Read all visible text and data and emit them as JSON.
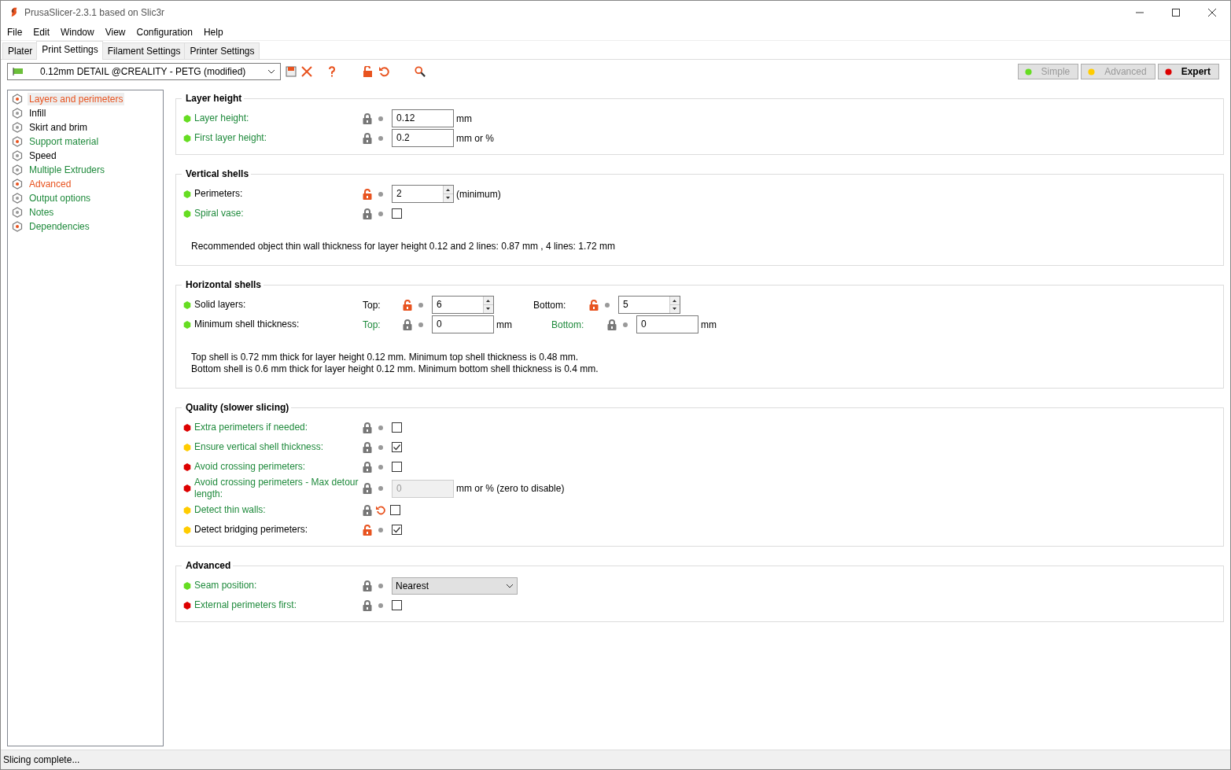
{
  "window": {
    "title": "PrusaSlicer-2.3.1 based on Slic3r"
  },
  "menu": [
    "File",
    "Edit",
    "Window",
    "View",
    "Configuration",
    "Help"
  ],
  "tabs": [
    {
      "label": "Plater",
      "selected": false
    },
    {
      "label": "Print Settings",
      "selected": true
    },
    {
      "label": "Filament Settings",
      "selected": false
    },
    {
      "label": "Printer Settings",
      "selected": false
    }
  ],
  "preset": {
    "value": "0.12mm DETAIL @CREALITY - PETG (modified)"
  },
  "modes": [
    {
      "label": "Simple",
      "color": "#66dd22",
      "selected": false
    },
    {
      "label": "Advanced",
      "color": "#ffcc00",
      "selected": false
    },
    {
      "label": "Expert",
      "color": "#dd0000",
      "selected": true
    }
  ],
  "sidebar": [
    {
      "label": "Layers and perimeters",
      "selected": true,
      "color": "#e8531f"
    },
    {
      "label": "Infill",
      "selected": false,
      "color": "#000000"
    },
    {
      "label": "Skirt and brim",
      "selected": false,
      "color": "#000000"
    },
    {
      "label": "Support material",
      "selected": false,
      "color": "#1f8a3c"
    },
    {
      "label": "Speed",
      "selected": false,
      "color": "#000000"
    },
    {
      "label": "Multiple Extruders",
      "selected": false,
      "color": "#1f8a3c"
    },
    {
      "label": "Advanced",
      "selected": false,
      "color": "#e8531f"
    },
    {
      "label": "Output options",
      "selected": false,
      "color": "#1f8a3c"
    },
    {
      "label": "Notes",
      "selected": false,
      "color": "#1f8a3c"
    },
    {
      "label": "Dependencies",
      "selected": false,
      "color": "#1f8a3c"
    }
  ],
  "groups": [
    {
      "title": "Layer height",
      "rows": [
        {
          "kind": "input",
          "label": "Layer height:",
          "modified": false,
          "color": "#66dd22",
          "locked": true,
          "undo": false,
          "value": "0.12",
          "unit": "mm"
        },
        {
          "kind": "input",
          "label": "First layer height:",
          "modified": false,
          "color": "#66dd22",
          "locked": true,
          "undo": false,
          "value": "0.2",
          "unit": "mm or %"
        }
      ]
    },
    {
      "title": "Vertical shells",
      "rows": [
        {
          "kind": "spin",
          "label": "Perimeters:",
          "modified": true,
          "color": "#66dd22",
          "locked": false,
          "undo": false,
          "value": "2",
          "unit": "(minimum)"
        },
        {
          "kind": "checkbox",
          "label": "Spiral vase:",
          "modified": false,
          "color": "#66dd22",
          "locked": true,
          "undo": false,
          "checked": false
        }
      ],
      "notes": [
        "Recommended object thin wall thickness for layer height 0.12 and 2 lines: 0.87 mm , 4 lines: 1.72 mm"
      ]
    },
    {
      "title": "Horizontal shells",
      "rows": [
        {
          "kind": "pair",
          "label": "Solid layers:",
          "modified": true,
          "color": "#66dd22",
          "parts": [
            {
              "label": "Top:",
              "modified": true,
              "locked": false,
              "spin": true,
              "value": "6"
            },
            {
              "label": "Bottom:",
              "modified": true,
              "locked": false,
              "spin": true,
              "value": "5"
            }
          ]
        },
        {
          "kind": "pair",
          "label": "Minimum shell thickness:",
          "modified": true,
          "color": "#66dd22",
          "parts": [
            {
              "label": "Top:",
              "modified": false,
              "locked": true,
              "spin": false,
              "value": "0",
              "unit": "mm"
            },
            {
              "label": "Bottom:",
              "modified": false,
              "locked": true,
              "spin": false,
              "value": "0",
              "unit": "mm"
            }
          ]
        }
      ],
      "notes": [
        "Top shell is 0.72 mm thick for layer height 0.12 mm. Minimum top shell thickness is 0.48 mm.",
        "Bottom shell is 0.6 mm thick for layer height 0.12 mm. Minimum bottom shell thickness is 0.4 mm."
      ]
    },
    {
      "title": "Quality (slower slicing)",
      "rows": [
        {
          "kind": "checkbox",
          "label": "Extra perimeters if needed:",
          "modified": false,
          "color": "#dd0000",
          "locked": true,
          "undo": false,
          "checked": false
        },
        {
          "kind": "checkbox",
          "label": "Ensure vertical shell thickness:",
          "modified": false,
          "color": "#ffcc00",
          "locked": true,
          "undo": false,
          "checked": true
        },
        {
          "kind": "checkbox",
          "label": "Avoid crossing perimeters:",
          "modified": false,
          "color": "#dd0000",
          "locked": true,
          "undo": false,
          "checked": false
        },
        {
          "kind": "input",
          "label": "Avoid crossing perimeters - Max detour length:",
          "modified": false,
          "color": "#dd0000",
          "locked": true,
          "undo": false,
          "value": "0",
          "unit": "mm or % (zero to disable)",
          "disabled": true
        },
        {
          "kind": "checkbox",
          "label": "Detect thin walls:",
          "modified": false,
          "color": "#ffcc00",
          "locked": true,
          "undo": true,
          "checked": false
        },
        {
          "kind": "checkbox",
          "label": "Detect bridging perimeters:",
          "modified": true,
          "color": "#ffcc00",
          "locked": false,
          "undo": false,
          "checked": true
        }
      ]
    },
    {
      "title": "Advanced",
      "rows": [
        {
          "kind": "select",
          "label": "Seam position:",
          "modified": false,
          "color": "#66dd22",
          "locked": true,
          "undo": false,
          "value": "Nearest"
        },
        {
          "kind": "checkbox",
          "label": "External perimeters first:",
          "modified": false,
          "color": "#dd0000",
          "locked": true,
          "undo": false,
          "checked": false
        }
      ]
    }
  ],
  "status_bar": {
    "text": "Slicing complete..."
  }
}
